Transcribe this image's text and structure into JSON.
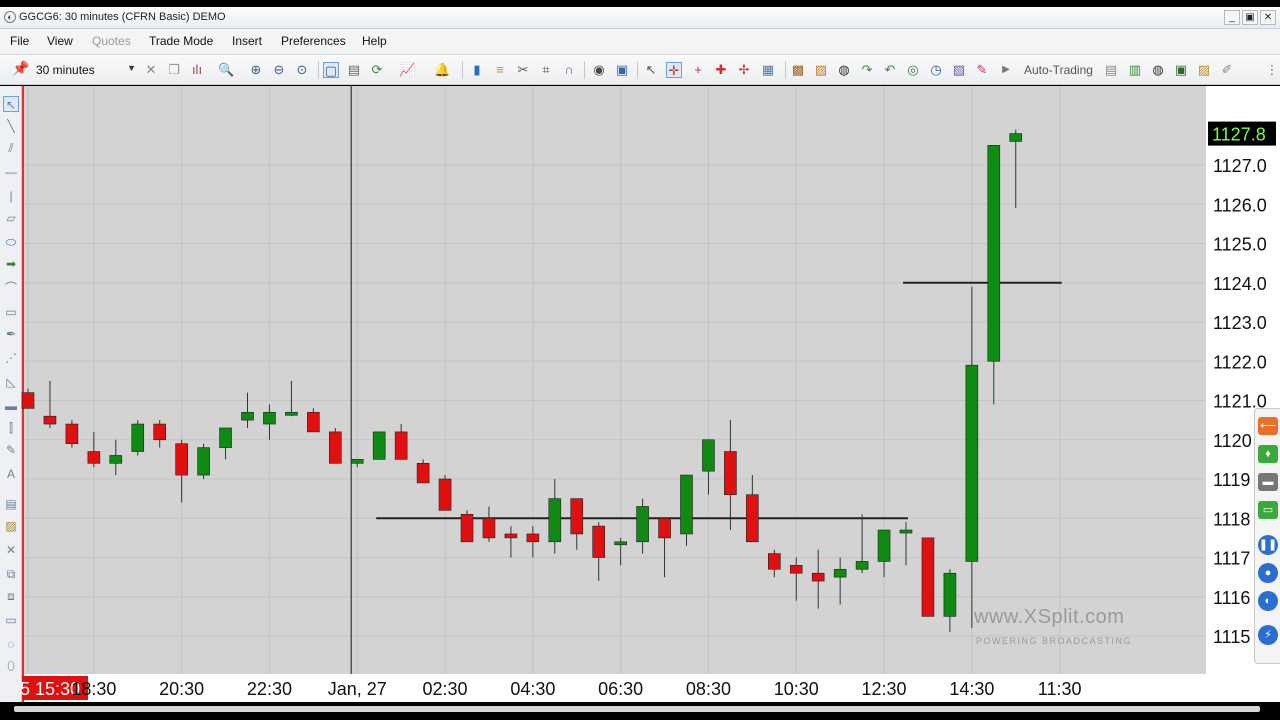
{
  "window": {
    "title": "GGCG6: 30 minutes (CFRN Basic) DEMO",
    "buttons": [
      "_",
      "▣",
      "✕"
    ]
  },
  "menu": [
    {
      "label": "File",
      "enabled": true
    },
    {
      "label": "View",
      "enabled": true
    },
    {
      "label": "Quotes",
      "enabled": false
    },
    {
      "label": "Trade Mode",
      "enabled": true
    },
    {
      "label": "Insert",
      "enabled": true
    },
    {
      "label": "Preferences",
      "enabled": true
    },
    {
      "label": "Help",
      "enabled": true
    }
  ],
  "toolbar": {
    "interval": "30 minutes",
    "auto_trading_label": "Auto-Trading"
  },
  "watermark": {
    "main": "www.XSplit.com",
    "sub": "POWERING BROADCASTING"
  },
  "colors": {
    "up": "#0f8a12",
    "down": "#e01010",
    "chart_bg": "#d3d3d3",
    "grid": "#c4c4c4",
    "last_price_bg": "#000000",
    "last_price_fg": "#7dff4a"
  },
  "chart_data": {
    "type": "candlestick",
    "last_price": "1127.8",
    "y_ticks": [
      "1127.0",
      "1126.0",
      "1125.0",
      "1124.0",
      "1123.0",
      "1122.0",
      "1121.0",
      "1120",
      "1119",
      "1118",
      "1117",
      "1116",
      "1115"
    ],
    "y_tick_values": [
      1127,
      1126,
      1125,
      1124,
      1123,
      1122,
      1121,
      1120,
      1119,
      1118,
      1117,
      1116,
      1115
    ],
    "x_ticks": [
      "5 15:30",
      "18:30",
      "20:30",
      "22:30",
      "Jan, 27",
      "02:30",
      "04:30",
      "06:30",
      "08:30",
      "10:30",
      "12:30",
      "14:30",
      "11:30"
    ],
    "x_tick_index": [
      0,
      3,
      7,
      11,
      15,
      19,
      23,
      27,
      31,
      35,
      39,
      43,
      47
    ],
    "horizontal_lines": [
      {
        "price": 1118.0,
        "from_index": 16,
        "to_index": 40
      },
      {
        "price": 1124.0,
        "from_index": 40,
        "to_index": 47
      }
    ],
    "vertical_line_index": 15,
    "candles": [
      {
        "o": 1121.2,
        "h": 1121.3,
        "l": 1120.8,
        "c": 1120.8
      },
      {
        "o": 1120.6,
        "h": 1121.5,
        "l": 1120.3,
        "c": 1120.4
      },
      {
        "o": 1120.4,
        "h": 1120.5,
        "l": 1119.8,
        "c": 1119.9
      },
      {
        "o": 1119.7,
        "h": 1120.2,
        "l": 1119.3,
        "c": 1119.4
      },
      {
        "o": 1119.4,
        "h": 1120.0,
        "l": 1119.1,
        "c": 1119.6
      },
      {
        "o": 1119.7,
        "h": 1120.5,
        "l": 1119.6,
        "c": 1120.4
      },
      {
        "o": 1120.4,
        "h": 1120.5,
        "l": 1119.8,
        "c": 1120.0
      },
      {
        "o": 1119.9,
        "h": 1120.0,
        "l": 1118.4,
        "c": 1119.1
      },
      {
        "o": 1119.1,
        "h": 1119.9,
        "l": 1119.0,
        "c": 1119.8
      },
      {
        "o": 1119.8,
        "h": 1120.3,
        "l": 1119.5,
        "c": 1120.3
      },
      {
        "o": 1120.5,
        "h": 1121.2,
        "l": 1120.3,
        "c": 1120.7
      },
      {
        "o": 1120.4,
        "h": 1120.9,
        "l": 1120.0,
        "c": 1120.7
      },
      {
        "o": 1120.7,
        "h": 1121.5,
        "l": 1120.6,
        "c": 1120.7
      },
      {
        "o": 1120.7,
        "h": 1120.8,
        "l": 1120.3,
        "c": 1120.2
      },
      {
        "o": 1120.2,
        "h": 1120.3,
        "l": 1119.8,
        "c": 1119.4
      },
      {
        "o": 1119.4,
        "h": 1119.5,
        "l": 1119.3,
        "c": 1119.5
      },
      {
        "o": 1119.5,
        "h": 1120.1,
        "l": 1119.5,
        "c": 1120.2
      },
      {
        "o": 1120.2,
        "h": 1120.4,
        "l": 1119.8,
        "c": 1119.5
      },
      {
        "o": 1119.4,
        "h": 1119.5,
        "l": 1119.0,
        "c": 1118.9
      },
      {
        "o": 1119.0,
        "h": 1119.1,
        "l": 1118.3,
        "c": 1118.2
      },
      {
        "o": 1118.1,
        "h": 1118.2,
        "l": 1117.7,
        "c": 1117.4
      },
      {
        "o": 1118.0,
        "h": 1118.3,
        "l": 1117.4,
        "c": 1117.5
      },
      {
        "o": 1117.6,
        "h": 1117.8,
        "l": 1117.0,
        "c": 1117.5
      },
      {
        "o": 1117.6,
        "h": 1117.8,
        "l": 1117.0,
        "c": 1117.4
      },
      {
        "o": 1117.4,
        "h": 1119.0,
        "l": 1117.1,
        "c": 1118.5
      },
      {
        "o": 1118.5,
        "h": 1118.5,
        "l": 1117.2,
        "c": 1117.6
      },
      {
        "o": 1117.8,
        "h": 1117.9,
        "l": 1116.4,
        "c": 1117.0
      },
      {
        "o": 1117.4,
        "h": 1117.5,
        "l": 1116.8,
        "c": 1117.4
      },
      {
        "o": 1117.4,
        "h": 1118.5,
        "l": 1117.1,
        "c": 1118.3
      },
      {
        "o": 1118.0,
        "h": 1118.0,
        "l": 1116.5,
        "c": 1117.5
      },
      {
        "o": 1117.6,
        "h": 1119.0,
        "l": 1117.3,
        "c": 1119.1
      },
      {
        "o": 1119.2,
        "h": 1120.0,
        "l": 1118.6,
        "c": 1120.0
      },
      {
        "o": 1119.7,
        "h": 1120.5,
        "l": 1117.7,
        "c": 1118.6
      },
      {
        "o": 1118.6,
        "h": 1119.1,
        "l": 1117.5,
        "c": 1117.4
      },
      {
        "o": 1117.1,
        "h": 1117.2,
        "l": 1116.5,
        "c": 1116.7
      },
      {
        "o": 1116.8,
        "h": 1117.0,
        "l": 1115.9,
        "c": 1116.6
      },
      {
        "o": 1116.6,
        "h": 1117.2,
        "l": 1115.7,
        "c": 1116.4
      },
      {
        "o": 1116.5,
        "h": 1117.0,
        "l": 1115.8,
        "c": 1116.7
      },
      {
        "o": 1116.7,
        "h": 1118.1,
        "l": 1116.6,
        "c": 1116.9
      },
      {
        "o": 1116.9,
        "h": 1117.7,
        "l": 1116.5,
        "c": 1117.7
      },
      {
        "o": 1117.7,
        "h": 1117.9,
        "l": 1116.8,
        "c": 1117.7
      },
      {
        "o": 1117.5,
        "h": 1117.5,
        "l": 1115.5,
        "c": 1115.5
      },
      {
        "o": 1115.5,
        "h": 1116.7,
        "l": 1115.1,
        "c": 1116.6
      },
      {
        "o": 1116.9,
        "h": 1123.9,
        "l": 1115.2,
        "c": 1121.9
      },
      {
        "o": 1122.0,
        "h": 1127.5,
        "l": 1120.9,
        "c": 1127.5
      },
      {
        "o": 1127.6,
        "h": 1127.9,
        "l": 1125.9,
        "c": 1127.8
      }
    ]
  }
}
